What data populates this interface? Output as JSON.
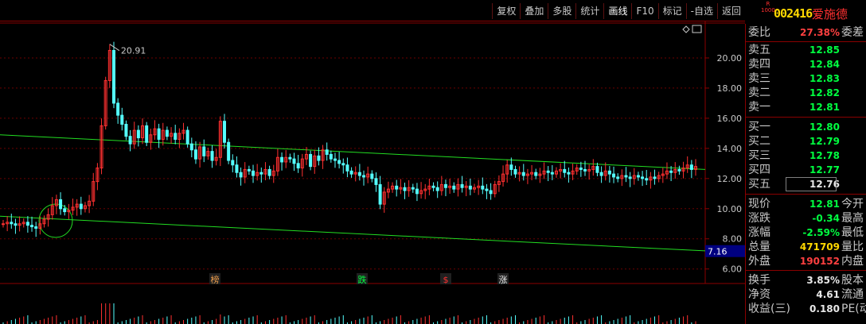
{
  "toolbar": {
    "buttons": [
      "复权",
      "叠加",
      "多股",
      "统计",
      "画线",
      "F10",
      "标记",
      "-自选",
      "返回"
    ]
  },
  "stock": {
    "badge_top": "R",
    "badge_bottom": "1000",
    "code": "002416",
    "name": "爱施德"
  },
  "chart_data": {
    "type": "candlestick",
    "ylim": [
      5.3,
      22
    ],
    "y_ticks": [
      "20.00",
      "18.00",
      "16.00",
      "14.00",
      "12.00",
      "10.00",
      "8.00",
      "6.00"
    ],
    "y_tick_values": [
      20,
      18,
      16,
      14,
      12,
      10,
      8,
      6
    ],
    "high_label": "20.91",
    "high_value": 20.91,
    "current_price_label": "7.16",
    "current_price_value": 7.16,
    "channel_upper": [
      14.9,
      12.6
    ],
    "channel_lower": [
      9.5,
      7.2
    ],
    "closes": [
      9.0,
      9.1,
      9.0,
      8.9,
      9.0,
      9.1,
      8.9,
      8.8,
      8.7,
      9.0,
      9.3,
      9.6,
      10.2,
      10.6,
      10.0,
      9.8,
      9.9,
      10.1,
      10.3,
      10.0,
      10.2,
      10.5,
      11.8,
      12.7,
      15.5,
      18.5,
      20.5,
      17.0,
      16.2,
      15.6,
      14.8,
      14.3,
      15.2,
      14.7,
      15.5,
      14.4,
      14.9,
      15.3,
      14.6,
      15.2,
      14.8,
      15.0,
      14.6,
      15.0,
      15.2,
      14.3,
      13.9,
      13.3,
      14.1,
      13.5,
      13.8,
      13.2,
      13.4,
      15.8,
      14.4,
      13.2,
      12.9,
      12.4,
      12.1,
      12.6,
      12.5,
      12.2,
      12.4,
      12.3,
      12.6,
      12.2,
      12.5,
      13.4,
      13.1,
      13.4,
      13.3,
      13.0,
      12.7,
      13.3,
      13.6,
      12.8,
      13.5,
      13.2,
      13.9,
      13.6,
      13.3,
      13.2,
      13.0,
      12.9,
      12.5,
      12.3,
      12.4,
      12.2,
      12.1,
      12.3,
      12.0,
      11.6,
      10.3,
      11.1,
      11.3,
      11.5,
      11.3,
      11.4,
      11.2,
      11.4,
      11.3,
      11.0,
      11.2,
      11.3,
      11.5,
      11.4,
      11.2,
      11.6,
      11.4,
      11.5,
      11.3,
      11.6,
      11.4,
      11.5,
      11.3,
      11.4,
      11.5,
      11.3,
      11.2,
      11.0,
      11.6,
      11.8,
      12.3,
      12.9,
      12.6,
      12.3,
      12.4,
      12.2,
      12.3,
      12.4,
      12.2,
      12.3,
      12.5,
      12.4,
      12.3,
      12.5,
      12.6,
      12.4,
      12.3,
      12.5,
      12.7,
      12.6,
      12.5,
      12.6,
      12.8,
      12.4,
      12.2,
      12.5,
      12.3,
      12.1,
      12.0,
      12.2,
      12.1,
      12.0,
      12.2,
      12.1,
      12.0,
      11.9,
      12.1,
      12.0,
      12.2,
      12.3,
      12.5,
      12.4,
      12.6,
      12.5,
      12.7,
      12.9,
      12.6,
      12.8
    ],
    "markers": [
      {
        "label": "榜",
        "color": "#e89a4a"
      },
      {
        "label": "跌",
        "color": "#00ff40"
      },
      {
        "label": "$",
        "color": "#ff3030"
      },
      {
        "label": "涨",
        "color": "#e8e8e8"
      }
    ]
  },
  "panel": {
    "ratio_label": "委比",
    "ratio_value": "27.38%",
    "ratio_extra": "委差",
    "asks": [
      {
        "label": "卖五",
        "price": "12.85"
      },
      {
        "label": "卖四",
        "price": "12.84"
      },
      {
        "label": "卖三",
        "price": "12.83"
      },
      {
        "label": "卖二",
        "price": "12.82"
      },
      {
        "label": "卖一",
        "price": "12.81"
      }
    ],
    "bids": [
      {
        "label": "买一",
        "price": "12.80"
      },
      {
        "label": "买二",
        "price": "12.79"
      },
      {
        "label": "买三",
        "price": "12.78"
      },
      {
        "label": "买四",
        "price": "12.77"
      },
      {
        "label": "买五",
        "price": "12.76"
      }
    ],
    "stats": [
      {
        "label": "现价",
        "value": "12.81",
        "extra": "今开",
        "color": "green"
      },
      {
        "label": "涨跌",
        "value": "-0.34",
        "extra": "最高",
        "color": "green"
      },
      {
        "label": "涨幅",
        "value": "-2.59%",
        "extra": "最低",
        "color": "green"
      },
      {
        "label": "总量",
        "value": "471709",
        "extra": "量比",
        "color": "yellow"
      },
      {
        "label": "外盘",
        "value": "190152",
        "extra": "内盘",
        "color": "red"
      }
    ],
    "fin": [
      {
        "label": "换手",
        "value": "3.85%",
        "extra": "股本"
      },
      {
        "label": "净资",
        "value": "4.61",
        "extra": "流通"
      },
      {
        "label": "收益(三)",
        "value": "0.180",
        "extra": "PE(动)"
      }
    ]
  }
}
